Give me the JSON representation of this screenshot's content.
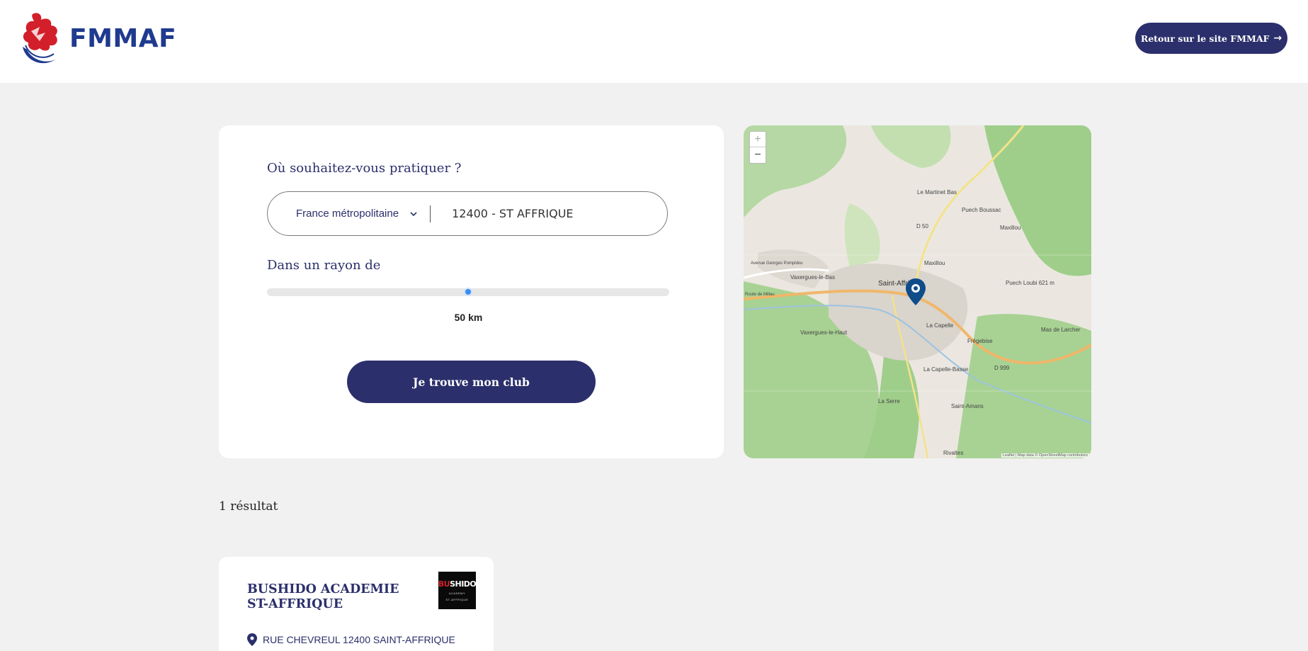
{
  "header": {
    "brand": "FMMAF",
    "back_button_label": "Retour sur le site FMMAF",
    "back_arrow": "→"
  },
  "search": {
    "location_question": "Où souhaitez-vous pratiquer ?",
    "region_selected": "France métropolitaine",
    "city_value": "12400 - ST AFFRIQUE",
    "radius_title": "Dans un rayon de",
    "radius_value_label": "50 km",
    "radius_fraction": 0.5,
    "submit_label": "Je trouve mon club"
  },
  "map": {
    "zoom_in": "+",
    "zoom_out": "−",
    "attribution": "Leaflet | Map data © OpenStreetMap contributors",
    "labels": [
      "Le Martinet Bas",
      "Puech Boussac",
      "D 50",
      "Maxillou",
      "Maxillou",
      "Vaxergues-le-Bas",
      "Saint-Affrique",
      "Puech Loubi 621 m",
      "La Capelle",
      "Frégebise",
      "Mas de Larcher",
      "Vaxergues-le-Haut",
      "La Capelle-Basse",
      "D 999",
      "La Serre",
      "Saint-Amans",
      "Rivaltes",
      "Avenue Georges Pompidou",
      "Route de Millau"
    ]
  },
  "results": {
    "count_label": "1 résultat",
    "clubs": [
      {
        "name": "BUSHIDO ACADEMIE ST-AFFRIQUE",
        "logo_text_main_a": "BU",
        "logo_text_main_b": "SHIDO",
        "logo_text_sub": "ACADEMY",
        "logo_text_small": "ST-AFFRIQUE",
        "address": "RUE CHEVREUL 12400 SAINT-AFFRIQUE"
      }
    ]
  },
  "colors": {
    "primary": "#2b2f6b",
    "accent_red": "#d21f2a",
    "slider_blue": "#3b8df0",
    "page_bg": "#f1f1f1"
  },
  "icons": [
    "fmmaf-rooster-logo",
    "chevron-down-icon",
    "arrow-right-icon",
    "map-marker-icon",
    "location-pin-icon"
  ]
}
